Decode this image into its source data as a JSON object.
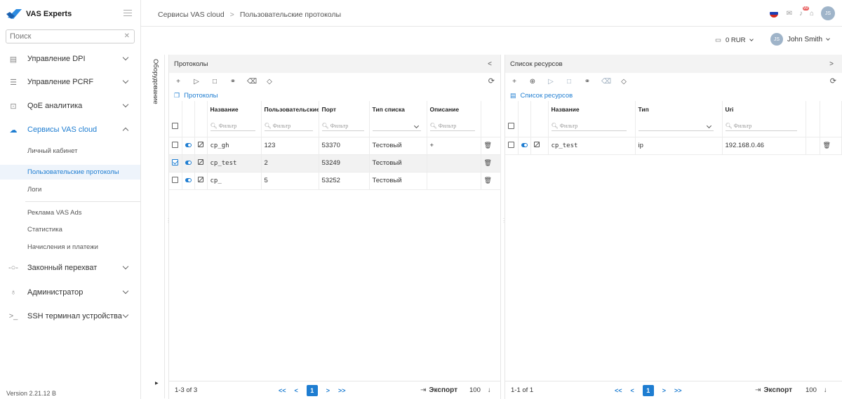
{
  "app": {
    "logo_text": "VAS Experts",
    "version": "Version 2.21.12 B"
  },
  "search": {
    "placeholder": "Поиск"
  },
  "sidebar": {
    "items": [
      {
        "label": "Управление DPI",
        "icon": "server-icon"
      },
      {
        "label": "Управление PCRF",
        "icon": "sliders-icon"
      },
      {
        "label": "QoE аналитика",
        "icon": "chart-icon"
      },
      {
        "label": "Сервисы VAS cloud",
        "icon": "cloud-icon"
      },
      {
        "label": "Законный перехват",
        "icon": "intercept-icon"
      },
      {
        "label": "Администратор",
        "icon": "users-icon"
      },
      {
        "label": "SSH терминал устройства",
        "icon": "terminal-icon"
      }
    ],
    "sub_items": [
      "Личный кабинет",
      "Пользовательские протоколы",
      "Логи",
      "Реклама VAS Ads",
      "Статистика",
      "Начисления и платежи"
    ]
  },
  "breadcrumb": {
    "root": "Сервисы VAS cloud",
    "separator": ">",
    "current": "Пользовательские протоколы"
  },
  "account": {
    "balance": "0 RUR",
    "user_name": "John Smith",
    "initials": "JS",
    "notification_badge": "99"
  },
  "vertical_tab": {
    "label": "Оборудование"
  },
  "protocols_panel": {
    "header": "Протоколы",
    "subtitle": "Протоколы",
    "columns": [
      "Название",
      "Пользовательские",
      "Порт",
      "Тип списка",
      "Описание"
    ],
    "filter_placeholder": "Фильтр",
    "rows": [
      {
        "name": "cp_gh",
        "user_value": "123",
        "port": "53370",
        "list_type": "Тестовый",
        "description": "+",
        "checked": false
      },
      {
        "name": "cp_test",
        "user_value": "2",
        "port": "53249",
        "list_type": "Тестовый",
        "description": "",
        "checked": true
      },
      {
        "name": "cp_",
        "user_value": "5",
        "port": "53252",
        "list_type": "Тестовый",
        "description": "",
        "checked": false
      }
    ],
    "footer": {
      "range": "1-3 of 3",
      "page": "1",
      "export": "Экспорт",
      "page_size": "100"
    }
  },
  "resources_panel": {
    "header": "Список ресурсов",
    "subtitle": "Список ресурсов",
    "columns": [
      "Название",
      "Тип",
      "Uri"
    ],
    "filter_placeholder": "Фильтр",
    "rows": [
      {
        "name": "cp_test",
        "type": "ip",
        "uri": "192.168.0.46"
      }
    ],
    "footer": {
      "range": "1-1 of 1",
      "page": "1",
      "export": "Экспорт",
      "page_size": "100"
    }
  },
  "pager_labels": {
    "first": "<<",
    "prev": "<",
    "next": ">",
    "last": ">>"
  },
  "colors": {
    "accent": "#1e7dd1",
    "header_bg": "#f3f3f3",
    "selected_row": "#f2f2f2"
  }
}
